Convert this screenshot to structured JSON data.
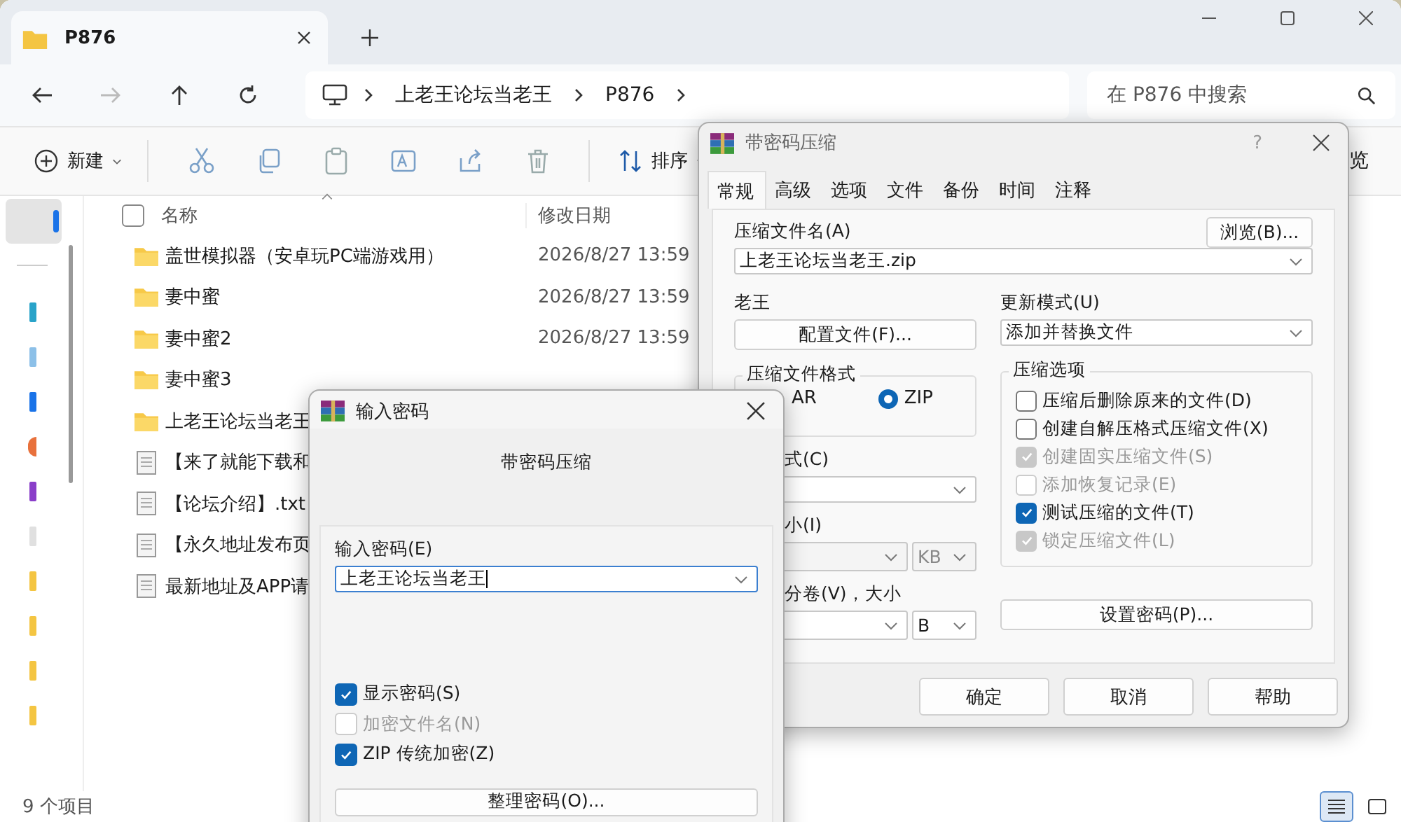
{
  "explorer": {
    "tabs": [
      {
        "label": "P876",
        "selected": true
      }
    ],
    "nav_buttons": [
      {
        "kind": "back",
        "disabled": false
      },
      {
        "kind": "forward",
        "disabled": true
      },
      {
        "kind": "up",
        "disabled": false
      },
      {
        "kind": "refresh",
        "disabled": false
      }
    ],
    "breadcrumb": [
      "上老王论坛当老王",
      "P876"
    ],
    "search": {
      "placeholder": "在 P876 中搜索"
    },
    "toolbar": {
      "new_label": "新建",
      "actions": [
        {
          "kind": "cut"
        },
        {
          "kind": "copy"
        },
        {
          "kind": "paste"
        },
        {
          "kind": "rename"
        },
        {
          "kind": "share"
        },
        {
          "kind": "delete"
        }
      ],
      "sort_label": "排序",
      "cut_off_label": "览"
    },
    "select_all_checked": false,
    "columns": [
      "名称",
      "修改日期"
    ],
    "rows": [
      {
        "kind": "folder",
        "name": "盖世模拟器（安卓玩PC端游戏用）",
        "modified": "2026/8/27 13:59"
      },
      {
        "kind": "folder",
        "name": "妻中蜜",
        "modified": "2026/8/27 13:59"
      },
      {
        "kind": "folder",
        "name": "妻中蜜2",
        "modified": "2026/8/27 13:59"
      },
      {
        "kind": "folder",
        "name": "妻中蜜3"
      },
      {
        "kind": "folder",
        "name": "上老王论坛当老王"
      },
      {
        "kind": "file",
        "name": "【来了就能下载和"
      },
      {
        "kind": "file",
        "name": "【论坛介绍】.txt"
      },
      {
        "kind": "file",
        "name": "【永久地址发布页"
      },
      {
        "kind": "file",
        "name": "最新地址及APP请"
      }
    ],
    "status": "9 个项目",
    "views": [
      {
        "kind": "details",
        "selected": true
      },
      {
        "kind": "tiles",
        "selected": false
      }
    ]
  },
  "archive_dialog": {
    "title": "带密码压缩",
    "help_glyph": "?",
    "tabs": [
      {
        "label": "常规",
        "selected": true
      },
      {
        "label": "高级",
        "selected": false
      },
      {
        "label": "选项",
        "selected": false
      },
      {
        "label": "文件",
        "selected": false
      },
      {
        "label": "备份",
        "selected": false
      },
      {
        "label": "时间",
        "selected": false
      },
      {
        "label": "注释",
        "selected": false
      }
    ],
    "archive_name_label": "压缩文件名(A)",
    "browse_button": "浏览(B)...",
    "archive_name": "上老王论坛当老王.zip",
    "profile_label": "老王",
    "profile_button": "配置文件(F)...",
    "update_label": "更新模式(U)",
    "update_value": "添加并替换文件",
    "format_group": "压缩文件格式",
    "rar_label_fragment": "AR",
    "zip_option": {
      "label": "ZIP",
      "selected": true
    },
    "method_label_fragment": "式(C)",
    "dict_label_fragment": "小(I)",
    "dict_unit": "KB",
    "split_label_fragment": "分卷(V)，大小",
    "split_unit": "B",
    "options_group": "压缩选项",
    "options": [
      {
        "label": "压缩后删除原来的文件(D)",
        "checked": false,
        "disabled": false
      },
      {
        "label": "创建自解压格式压缩文件(X)",
        "checked": false,
        "disabled": false
      },
      {
        "label": "创建固实压缩文件(S)",
        "checked": true,
        "disabled": true
      },
      {
        "label": "添加恢复记录(E)",
        "checked": false,
        "disabled": true
      },
      {
        "label": "测试压缩的文件(T)",
        "checked": true,
        "disabled": false
      },
      {
        "label": "锁定压缩文件(L)",
        "checked": true,
        "disabled": true
      }
    ],
    "set_password_button": "设置密码(P)...",
    "buttons": [
      "确定",
      "取消",
      "帮助"
    ]
  },
  "password_dialog": {
    "title": "输入密码",
    "subtitle": "带密码压缩",
    "password_label": "输入密码(E)",
    "password_value": "上老王论坛当老王",
    "options": [
      {
        "label": "显示密码(S)",
        "checked": true,
        "disabled": false
      },
      {
        "label": "加密文件名(N)",
        "checked": false,
        "disabled": true
      },
      {
        "label": "ZIP 传统加密(Z)",
        "checked": true,
        "disabled": false
      }
    ],
    "organize_button": "整理密码(O)..."
  }
}
